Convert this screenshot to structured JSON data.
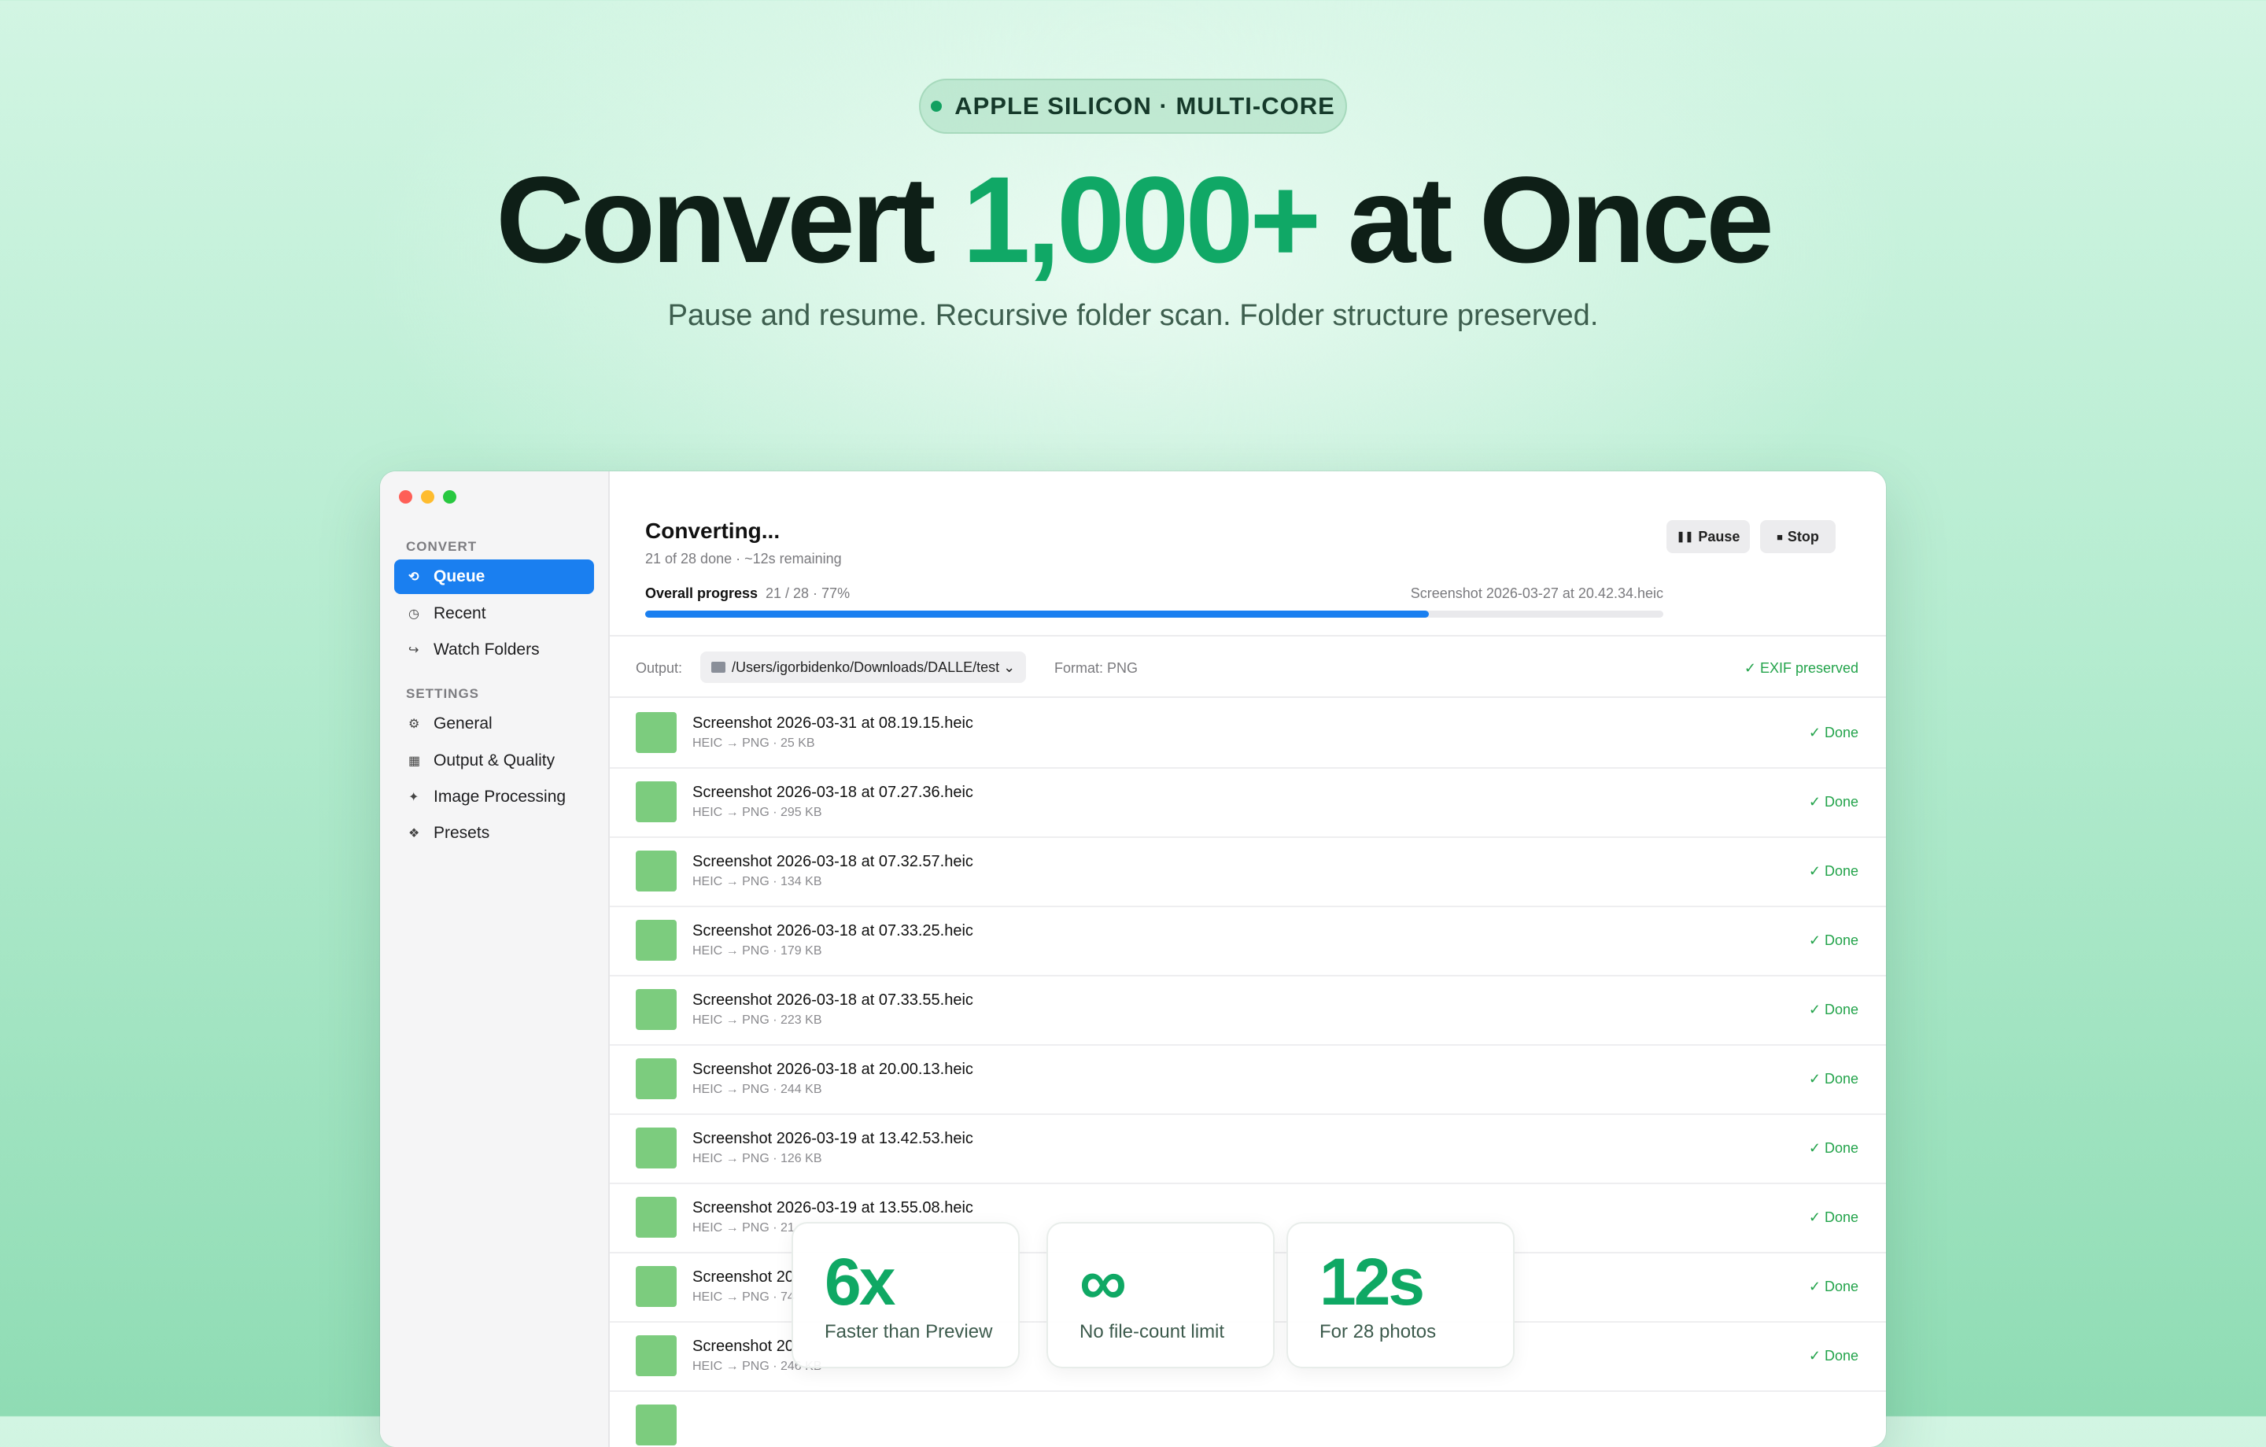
{
  "hero": {
    "badge": "APPLE SILICON · MULTI-CORE",
    "headline_pre": "Convert ",
    "headline_accent": "1,000+",
    "headline_post": " at Once",
    "subline": "Pause and resume. Recursive folder scan. Folder structure preserved."
  },
  "sidebar": {
    "section_convert": "CONVERT",
    "convert_items": [
      {
        "label": "Queue",
        "icon": "queue-icon",
        "glyph": "⟲"
      },
      {
        "label": "Recent",
        "icon": "clock-icon",
        "glyph": "◷"
      },
      {
        "label": "Watch Folders",
        "icon": "watch-folder-icon",
        "glyph": "↪"
      }
    ],
    "section_settings": "SETTINGS",
    "settings_items": [
      {
        "label": "General",
        "icon": "gear-icon",
        "glyph": "⚙"
      },
      {
        "label": "Output & Quality",
        "icon": "output-icon",
        "glyph": "▦"
      },
      {
        "label": "Image Processing",
        "icon": "sparkle-icon",
        "glyph": "✦"
      },
      {
        "label": "Presets",
        "icon": "presets-icon",
        "glyph": "❖"
      }
    ]
  },
  "status": {
    "title": "Converting...",
    "subtitle": "21 of 28 done · ~12s remaining",
    "pause_label": "Pause",
    "pause_glyph": "❚❚",
    "stop_label": "Stop",
    "stop_glyph": "■",
    "progress_label": "Overall progress",
    "progress_count": "21 / 28 · 77%",
    "progress_value": 0.77,
    "current_file": "Screenshot 2026-03-27 at 20.42.34.heic"
  },
  "output": {
    "label": "Output:",
    "path": "/Users/igorbidenko/Downloads/DALLE/test ⌄",
    "format": "Format: PNG",
    "exif": "✓ EXIF preserved"
  },
  "files": [
    {
      "name": "Screenshot 2026-03-31 at 08.19.15.heic",
      "meta": "HEIC → PNG · 25 KB",
      "status": "✓ Done"
    },
    {
      "name": "Screenshot 2026-03-18 at 07.27.36.heic",
      "meta": "HEIC → PNG · 295 KB",
      "status": "✓ Done"
    },
    {
      "name": "Screenshot 2026-03-18 at 07.32.57.heic",
      "meta": "HEIC → PNG · 134 KB",
      "status": "✓ Done"
    },
    {
      "name": "Screenshot 2026-03-18 at 07.33.25.heic",
      "meta": "HEIC → PNG · 179 KB",
      "status": "✓ Done"
    },
    {
      "name": "Screenshot 2026-03-18 at 07.33.55.heic",
      "meta": "HEIC → PNG · 223 KB",
      "status": "✓ Done"
    },
    {
      "name": "Screenshot 2026-03-18 at 20.00.13.heic",
      "meta": "HEIC → PNG · 244 KB",
      "status": "✓ Done"
    },
    {
      "name": "Screenshot 2026-03-19 at 13.42.53.heic",
      "meta": "HEIC → PNG · 126 KB",
      "status": "✓ Done"
    },
    {
      "name": "Screenshot 2026-03-19 at 13.55.08.heic",
      "meta": "HEIC → PNG · 21",
      "status": "✓ Done"
    },
    {
      "name": "Screenshot 20",
      "meta": "HEIC → PNG · 74",
      "status": "✓ Done"
    },
    {
      "name": "Screenshot 20",
      "meta": "HEIC → PNG · 246 KB",
      "status": "✓ Done"
    },
    {
      "name": "",
      "meta": "",
      "status": ""
    }
  ],
  "stats": [
    {
      "value": "6x",
      "label": "Faster than Preview"
    },
    {
      "value": "∞",
      "label": "No file-count limit"
    },
    {
      "value": "12s",
      "label": "For 28 photos"
    }
  ],
  "colors": {
    "accent_green": "#10a866",
    "selection_blue": "#1a7ff0",
    "done_green": "#22a34a",
    "thumb_green": "#7ccc7e"
  }
}
